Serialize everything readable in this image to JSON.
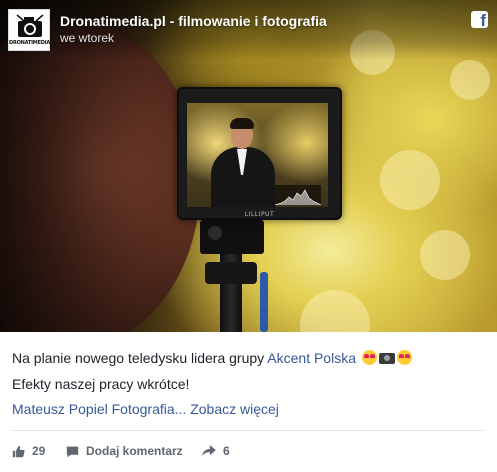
{
  "header": {
    "page_name": "Dronatimedia.pl - filmowanie i fotografia",
    "time": "we wtorek",
    "avatar_text": "DRONATIMEDIA",
    "platform_icon": "facebook-icon"
  },
  "post": {
    "line1_text": "Na planie nowego teledysku lidera grupy ",
    "line1_link": "Akcent Polska",
    "line2_text": "Efekty naszej pracy wkrótce!",
    "line3_author": "Mateusz Popiel Fotografia...",
    "line3_more": "Zobacz więcej",
    "emojis": [
      "heart-eyes-emoji",
      "camera-emoji",
      "heart-eyes-emoji"
    ]
  },
  "photo": {
    "monitor_brand": "LILLIPUT"
  },
  "actions": {
    "likes_count": "29",
    "comment_label": "Dodaj komentarz",
    "shares_count": "6"
  },
  "colors": {
    "link": "#365899",
    "text": "#1d2129",
    "meta": "#606770",
    "facebook_blue": "#3b5998"
  }
}
